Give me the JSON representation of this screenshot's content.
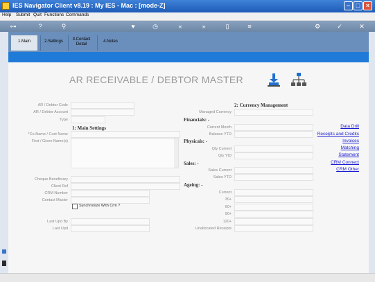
{
  "window": {
    "title": "IES Navigator Client v8.19 : My IES - Mac :      [mode-Z]"
  },
  "menu": {
    "items": [
      "Help",
      "Submit",
      "Quit",
      "Functions",
      "Commands"
    ]
  },
  "tabs": [
    {
      "label_line1": "1.Main",
      "label_line2": ""
    },
    {
      "label_line1": "2.Settings",
      "label_line2": ""
    },
    {
      "label_line1": "3.Contact",
      "label_line2": "Detail"
    },
    {
      "label_line1": "4.Notes",
      "label_line2": ""
    }
  ],
  "form": {
    "title": "AR RECEIVABLE / DEBTOR MASTER"
  },
  "left_labels": {
    "ar_code": "AR / Debtor Code",
    "ar_account": "AR / Debtor Account",
    "type": "Type",
    "co_name": "*Co.Name / Cust Name",
    "first_names": "First / Given Name(s)",
    "cheque": "Cheque Beneficiary",
    "client_ref": "Client Ref",
    "crm_number": "CRM Number",
    "contact_master": "Contact Master",
    "last_upd_by": "Last Upd By",
    "last_upd": "Last Upd"
  },
  "sections": {
    "main_settings": "1: Main Settings",
    "currency": "2: Currency Management",
    "financials": "Financials: -",
    "physicals": "Physicals: -",
    "sales": "Sales: -",
    "ageing": "Ageing: -"
  },
  "right_labels": {
    "managed_currency": "Managed Currency",
    "current_month": "Current Month",
    "balance_ytd": "Balance YTD",
    "qty_current": "Qty Current",
    "qty_ytd": "Qty YtD",
    "sales_current": "Sales Current",
    "sales_ytd": "Sales YTD",
    "current": "Current",
    "d30": "30+",
    "d60": "60+",
    "d90": "90+",
    "d120": "120+",
    "unallocated": "Unallocated Receipts"
  },
  "checkbox": {
    "sync_crm": "Synchronize With Crm ?"
  },
  "links": [
    "Data Drill",
    "Receipts and Credits",
    "Invoices",
    "Matching",
    "Statement",
    "CRM Connect",
    "CRM Other"
  ]
}
